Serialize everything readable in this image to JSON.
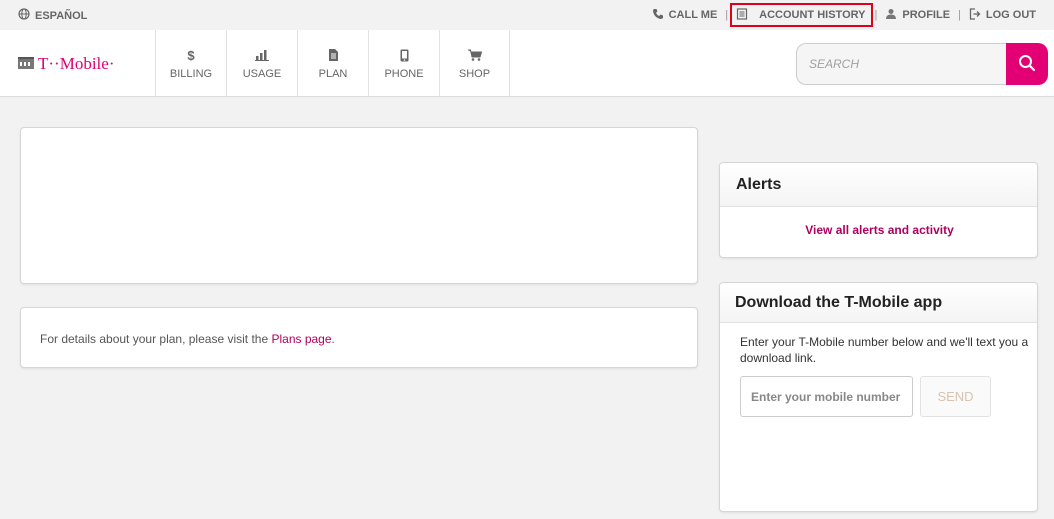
{
  "utility": {
    "language": "ESPAÑOL",
    "call_me": "CALL ME",
    "account_history": "ACCOUNT HISTORY",
    "profile": "PROFILE",
    "log_out": "LOG OUT",
    "separator": "|"
  },
  "brand": {
    "name": "T··Mobile·",
    "color": "#e20074"
  },
  "nav": {
    "items": [
      {
        "label": "BILLING",
        "icon": "dollar-icon"
      },
      {
        "label": "USAGE",
        "icon": "bar-chart-icon"
      },
      {
        "label": "PLAN",
        "icon": "document-icon"
      },
      {
        "label": "PHONE",
        "icon": "phone-icon"
      },
      {
        "label": "SHOP",
        "icon": "cart-icon"
      }
    ],
    "billing_symbol": "$"
  },
  "search": {
    "placeholder": "SEARCH"
  },
  "plan_notice": {
    "prefix": "For details about your plan, please visit the ",
    "link": "Plans page",
    "suffix": "."
  },
  "alerts": {
    "title": "Alerts",
    "link": "View all alerts and activity"
  },
  "app_download": {
    "title": "Download the T-Mobile app",
    "description": "Enter your T-Mobile number below and we'll text you a download link.",
    "input_placeholder": "Enter your mobile number",
    "send_label": "SEND"
  },
  "colors": {
    "accent": "#e20074",
    "highlight_border": "#e0001a",
    "link": "#b0005f"
  }
}
